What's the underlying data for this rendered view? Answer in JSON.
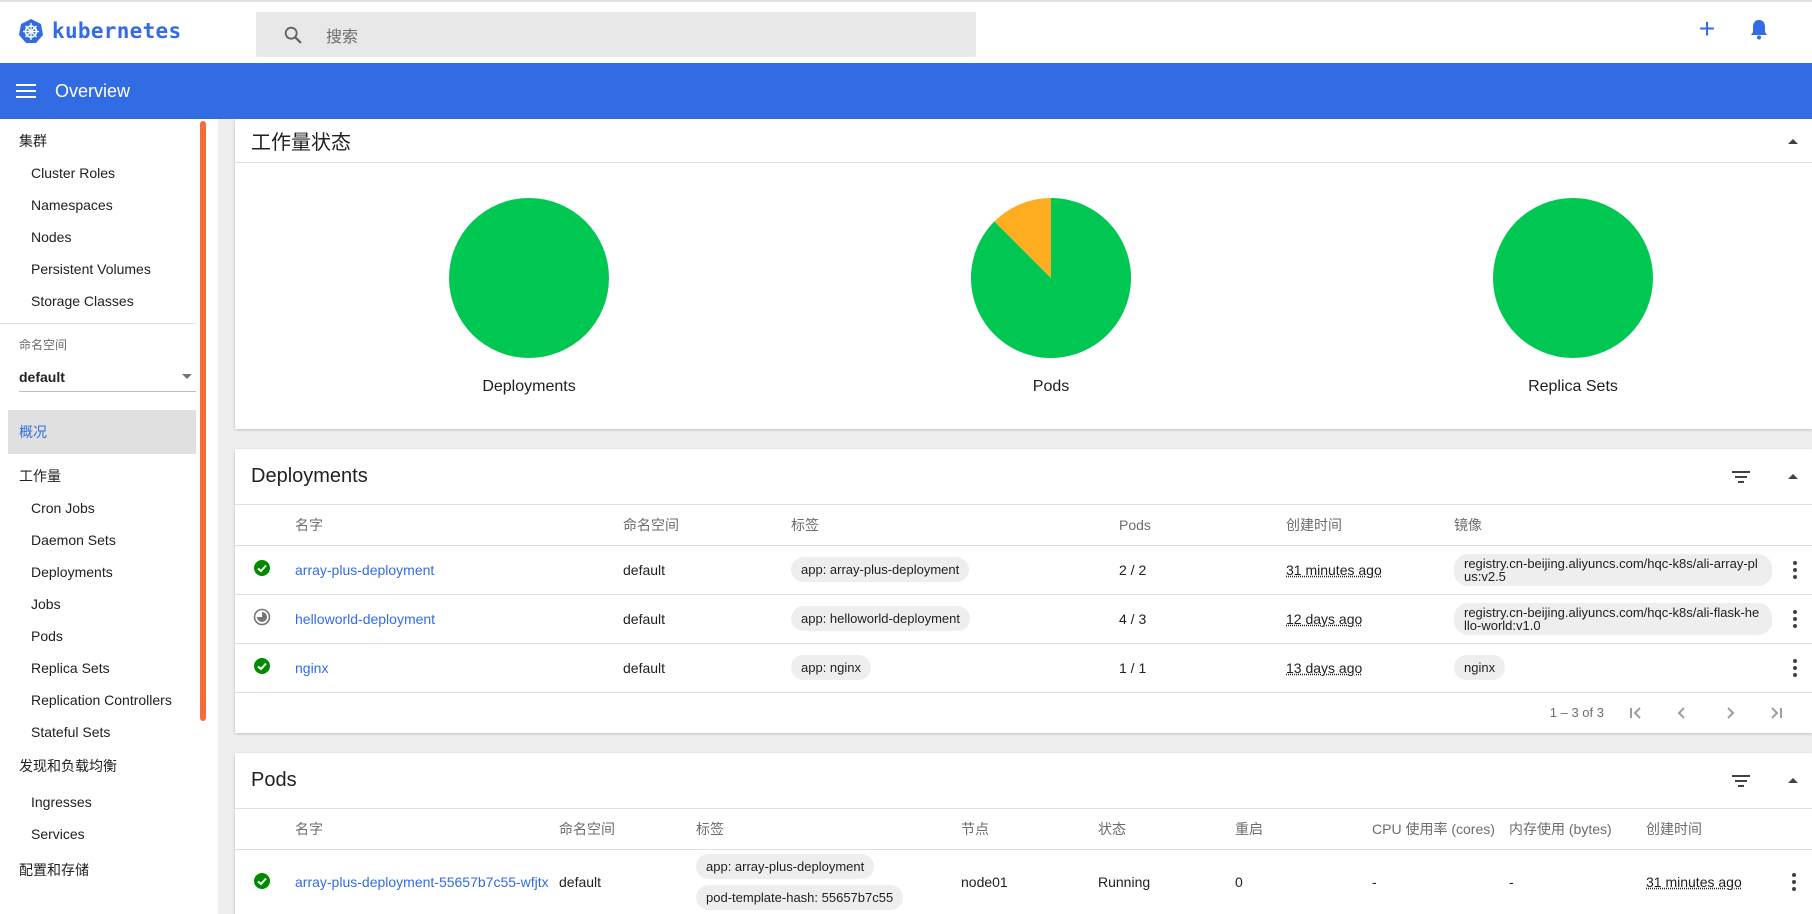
{
  "topbar": {
    "logo_text": "kubernetes",
    "search_placeholder": "搜索",
    "plus_icon": "+",
    "colors": {
      "brand": "#326ce5"
    }
  },
  "appbar": {
    "title": "Overview"
  },
  "sidebar": {
    "cluster_header": "集群",
    "cluster_items": [
      "Cluster Roles",
      "Namespaces",
      "Nodes",
      "Persistent Volumes",
      "Storage Classes"
    ],
    "namespace_label": "命名空间",
    "namespace_value": "default",
    "overview_label": "概况",
    "workloads_header": "工作量",
    "workload_items": [
      "Cron Jobs",
      "Daemon Sets",
      "Deployments",
      "Jobs",
      "Pods",
      "Replica Sets",
      "Replication Controllers",
      "Stateful Sets"
    ],
    "discovery_header": "发现和负载均衡",
    "discovery_items": [
      "Ingresses",
      "Services"
    ],
    "config_header": "配置和存储"
  },
  "workload_status": {
    "title": "工作量状态",
    "charts": [
      {
        "label": "Deployments"
      },
      {
        "label": "Pods"
      },
      {
        "label": "Replica Sets"
      }
    ]
  },
  "chart_data": [
    {
      "type": "pie",
      "title": "Deployments",
      "slices": [
        {
          "value": 1.0,
          "color": "#00c752"
        }
      ]
    },
    {
      "type": "pie",
      "title": "Pods",
      "slices": [
        {
          "value": 0.875,
          "color": "#00c752"
        },
        {
          "value": 0.125,
          "color": "#ffad20"
        }
      ]
    },
    {
      "type": "pie",
      "title": "Replica Sets",
      "slices": [
        {
          "value": 1.0,
          "color": "#00c752"
        }
      ]
    }
  ],
  "deployments": {
    "title": "Deployments",
    "columns": [
      "名字",
      "命名空间",
      "标签",
      "Pods",
      "创建时间",
      "镜像"
    ],
    "rows": [
      {
        "status": "ok",
        "name": "array-plus-deployment",
        "namespace": "default",
        "label": "app: array-plus-deployment",
        "pods": "2 / 2",
        "created": "31 minutes ago",
        "image": "registry.cn-beijing.aliyuncs.com/hqc-k8s/ali-array-plus:v2.5"
      },
      {
        "status": "pending",
        "name": "helloworld-deployment",
        "namespace": "default",
        "label": "app: helloworld-deployment",
        "pods": "4 / 3",
        "created": "12 days ago",
        "image": "registry.cn-beijing.aliyuncs.com/hqc-k8s/ali-flask-hello-world:v1.0"
      },
      {
        "status": "ok",
        "name": "nginx",
        "namespace": "default",
        "label": "app: nginx",
        "pods": "1 / 1",
        "created": "13 days ago",
        "image": "nginx"
      }
    ],
    "pager_text": "1 – 3 of 3"
  },
  "pods": {
    "title": "Pods",
    "columns": [
      "名字",
      "命名空间",
      "标签",
      "节点",
      "状态",
      "重启",
      "CPU 使用率 (cores)",
      "内存使用 (bytes)",
      "创建时间"
    ],
    "rows": [
      {
        "status": "ok",
        "name": "array-plus-deployment-55657b7c55-wfjtx",
        "namespace": "default",
        "labels": [
          "app: array-plus-deployment",
          "pod-template-hash: 55657b7c55"
        ],
        "node": "node01",
        "state": "Running",
        "restarts": "0",
        "cpu": "-",
        "memory": "-",
        "created": "31 minutes ago"
      }
    ]
  },
  "colors": {
    "status_ok": "#008a00",
    "pie_green": "#00c752",
    "pie_orange": "#ffad20",
    "sidebar_scrollbar": "#f26d3d"
  }
}
